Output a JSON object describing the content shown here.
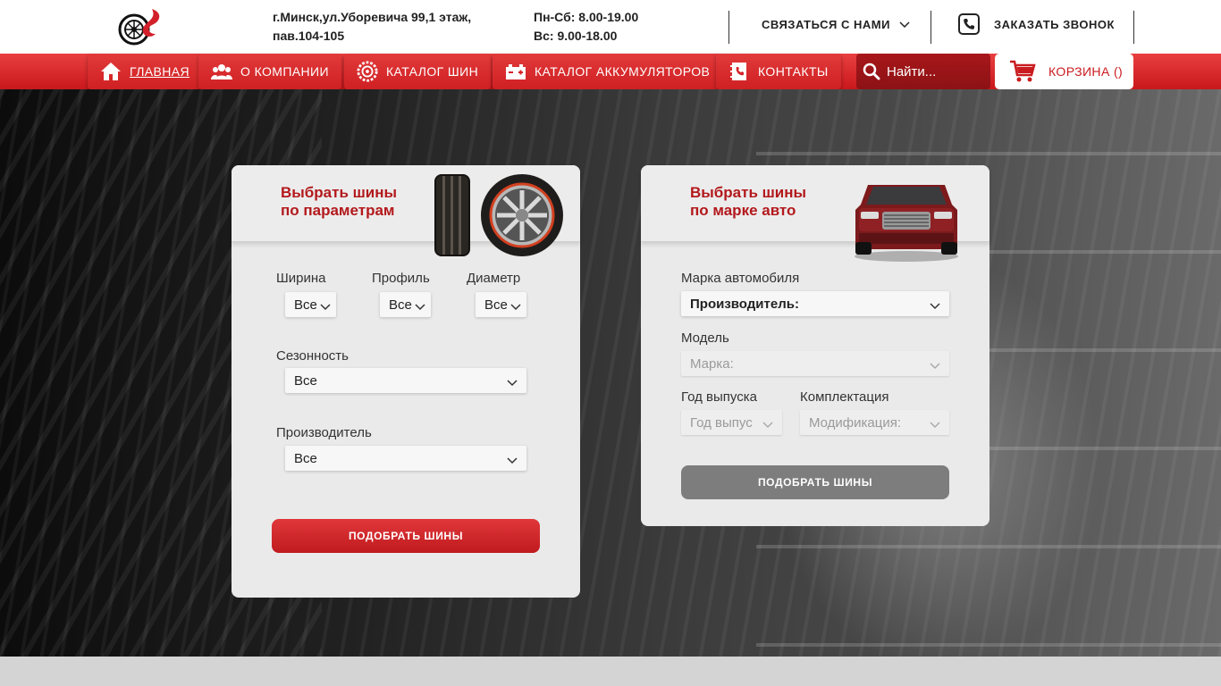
{
  "header": {
    "address_line1": "г.Минск,ул.Уборевича 99,1 этаж,",
    "address_line2": "пав.104-105",
    "hours_line1": "Пн-Сб: 8.00-19.00",
    "hours_line2": "Вс: 9.00-18.00",
    "contact_label": "СВЯЗАТЬСЯ С НАМИ",
    "callback_label": "ЗАКАЗАТЬ ЗВОНОК"
  },
  "nav": {
    "items": [
      {
        "label": "ГЛАВНАЯ",
        "icon": "home-icon"
      },
      {
        "label": "О КОМПАНИИ",
        "icon": "users-icon"
      },
      {
        "label": "КАТАЛОГ ШИН",
        "icon": "tire-icon"
      },
      {
        "label": "КАТАЛОГ АККУМУЛЯТОРОВ",
        "icon": "battery-icon"
      },
      {
        "label": "КОНТАКТЫ",
        "icon": "contacts-icon"
      }
    ],
    "search_placeholder": "Найти...",
    "cart_label": "КОРЗИНА ()"
  },
  "params_panel": {
    "title_line1": "Выбрать шины",
    "title_line2": "по параметрам",
    "width_label": "Ширина",
    "width_value": "Все",
    "profile_label": "Профиль",
    "profile_value": "Все",
    "diameter_label": "Диаметр",
    "diameter_value": "Все",
    "season_label": "Сезонность",
    "season_value": "Все",
    "manufacturer_label": "Производитель",
    "manufacturer_value": "Все",
    "submit_label": "ПОДОБРАТЬ ШИНЫ"
  },
  "car_panel": {
    "title_line1": "Выбрать шины",
    "title_line2": "по марке авто",
    "brand_label": "Марка автомобиля",
    "brand_value": "Производитель:",
    "model_label": "Модель",
    "model_value": "Марка:",
    "year_label": "Год выпуска",
    "year_value": "Год выпус",
    "trim_label": "Комплектация",
    "trim_value": "Модификация:",
    "submit_label": "ПОДОБРАТЬ ШИНЫ"
  },
  "colors": {
    "brand_red": "#c91b1f",
    "nav_red": "#e23a3a",
    "panel_bg": "#eaeaea"
  }
}
